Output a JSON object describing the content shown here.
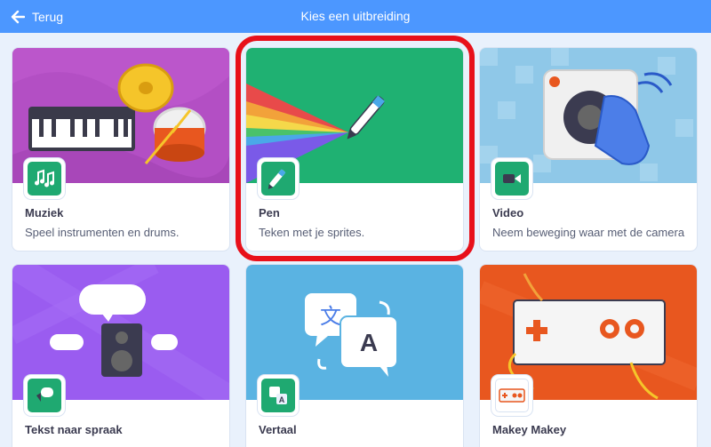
{
  "header": {
    "back_label": "Terug",
    "title": "Kies een uitbreiding",
    "color": "#4c97ff"
  },
  "extensions": [
    {
      "name": "Muziek",
      "description": "Speel instrumenten en drums.",
      "image_color": "#b34fc4",
      "icon_color": "#1fa971",
      "icon": "music-notes-icon"
    },
    {
      "name": "Pen",
      "description": "Teken met je sprites.",
      "image_color": "#1fb172",
      "icon_color": "#1fa971",
      "icon": "pen-icon",
      "highlighted": true
    },
    {
      "name": "Video",
      "description": "Neem beweging waar met de camera",
      "image_color": "#8fc8e8",
      "icon_color": "#1fa971",
      "icon": "video-camera-icon"
    },
    {
      "name": "Tekst naar spraak",
      "description": "",
      "image_color": "#9a5cf0",
      "icon_color": "#1fa971",
      "icon": "speech-bubble-icon"
    },
    {
      "name": "Vertaal",
      "description": "",
      "image_color": "#5ab3e2",
      "icon_color": "#1fa971",
      "icon": "translate-icon"
    },
    {
      "name": "Makey Makey",
      "description": "",
      "image_color": "#e8571f",
      "icon_color": "#1fa971",
      "icon": "makey-makey-icon"
    }
  ],
  "highlight_color": "#e8101a"
}
